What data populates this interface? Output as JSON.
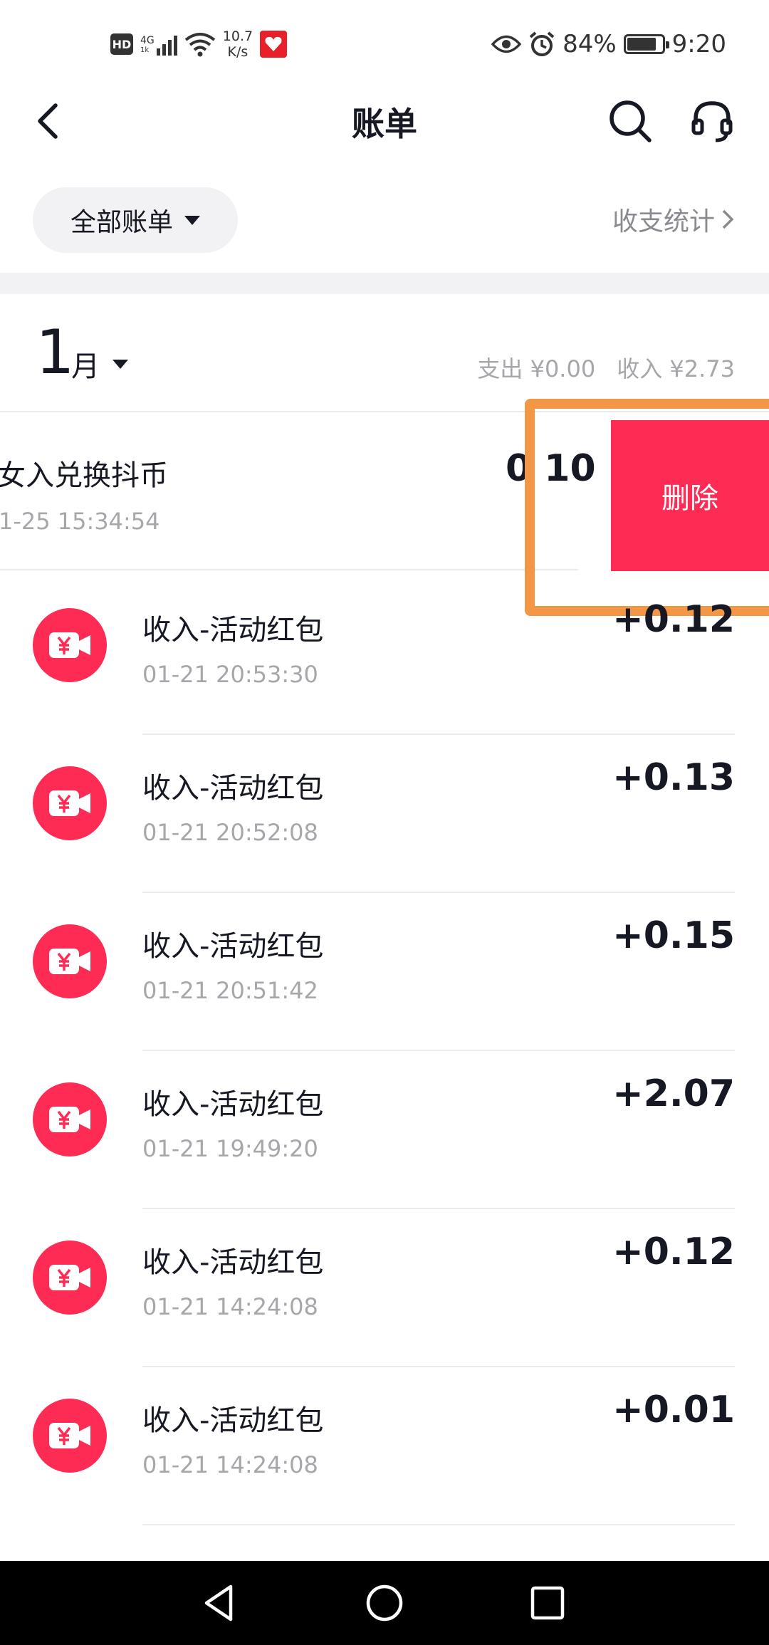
{
  "status_bar": {
    "hd": "HD",
    "network": "4G",
    "network_sub": "1k",
    "speed_value": "10.7",
    "speed_unit": "K/s",
    "battery_percent": "84%",
    "battery_level": 0.84,
    "time": "9:20"
  },
  "header": {
    "title": "账单"
  },
  "filter": {
    "label": "全部账单",
    "stats_link": "收支统计"
  },
  "month": {
    "number": "1",
    "unit": "月",
    "expense": "支出 ¥0.00",
    "income": "收入 ¥2.73"
  },
  "swiped_item": {
    "title": "收入兑换抖币",
    "title_visible": "女入兑换抖币",
    "time_visible": "1-25 15:34:54",
    "amount_visible": "0 10",
    "delete_label": "删除"
  },
  "transactions": [
    {
      "title": "收入-活动红包",
      "time": "01-21 20:53:30",
      "amount": "+0.12"
    },
    {
      "title": "收入-活动红包",
      "time": "01-21 20:52:08",
      "amount": "+0.13"
    },
    {
      "title": "收入-活动红包",
      "time": "01-21 20:51:42",
      "amount": "+0.15"
    },
    {
      "title": "收入-活动红包",
      "time": "01-21 19:49:20",
      "amount": "+2.07"
    },
    {
      "title": "收入-活动红包",
      "time": "01-21 14:24:08",
      "amount": "+0.12"
    },
    {
      "title": "收入-活动红包",
      "time": "01-21 14:24:08",
      "amount": "+0.01"
    }
  ],
  "colors": {
    "accent": "#fe2c55",
    "highlight": "#f39646",
    "text_primary": "#161823",
    "text_secondary": "#a6a7ab"
  }
}
